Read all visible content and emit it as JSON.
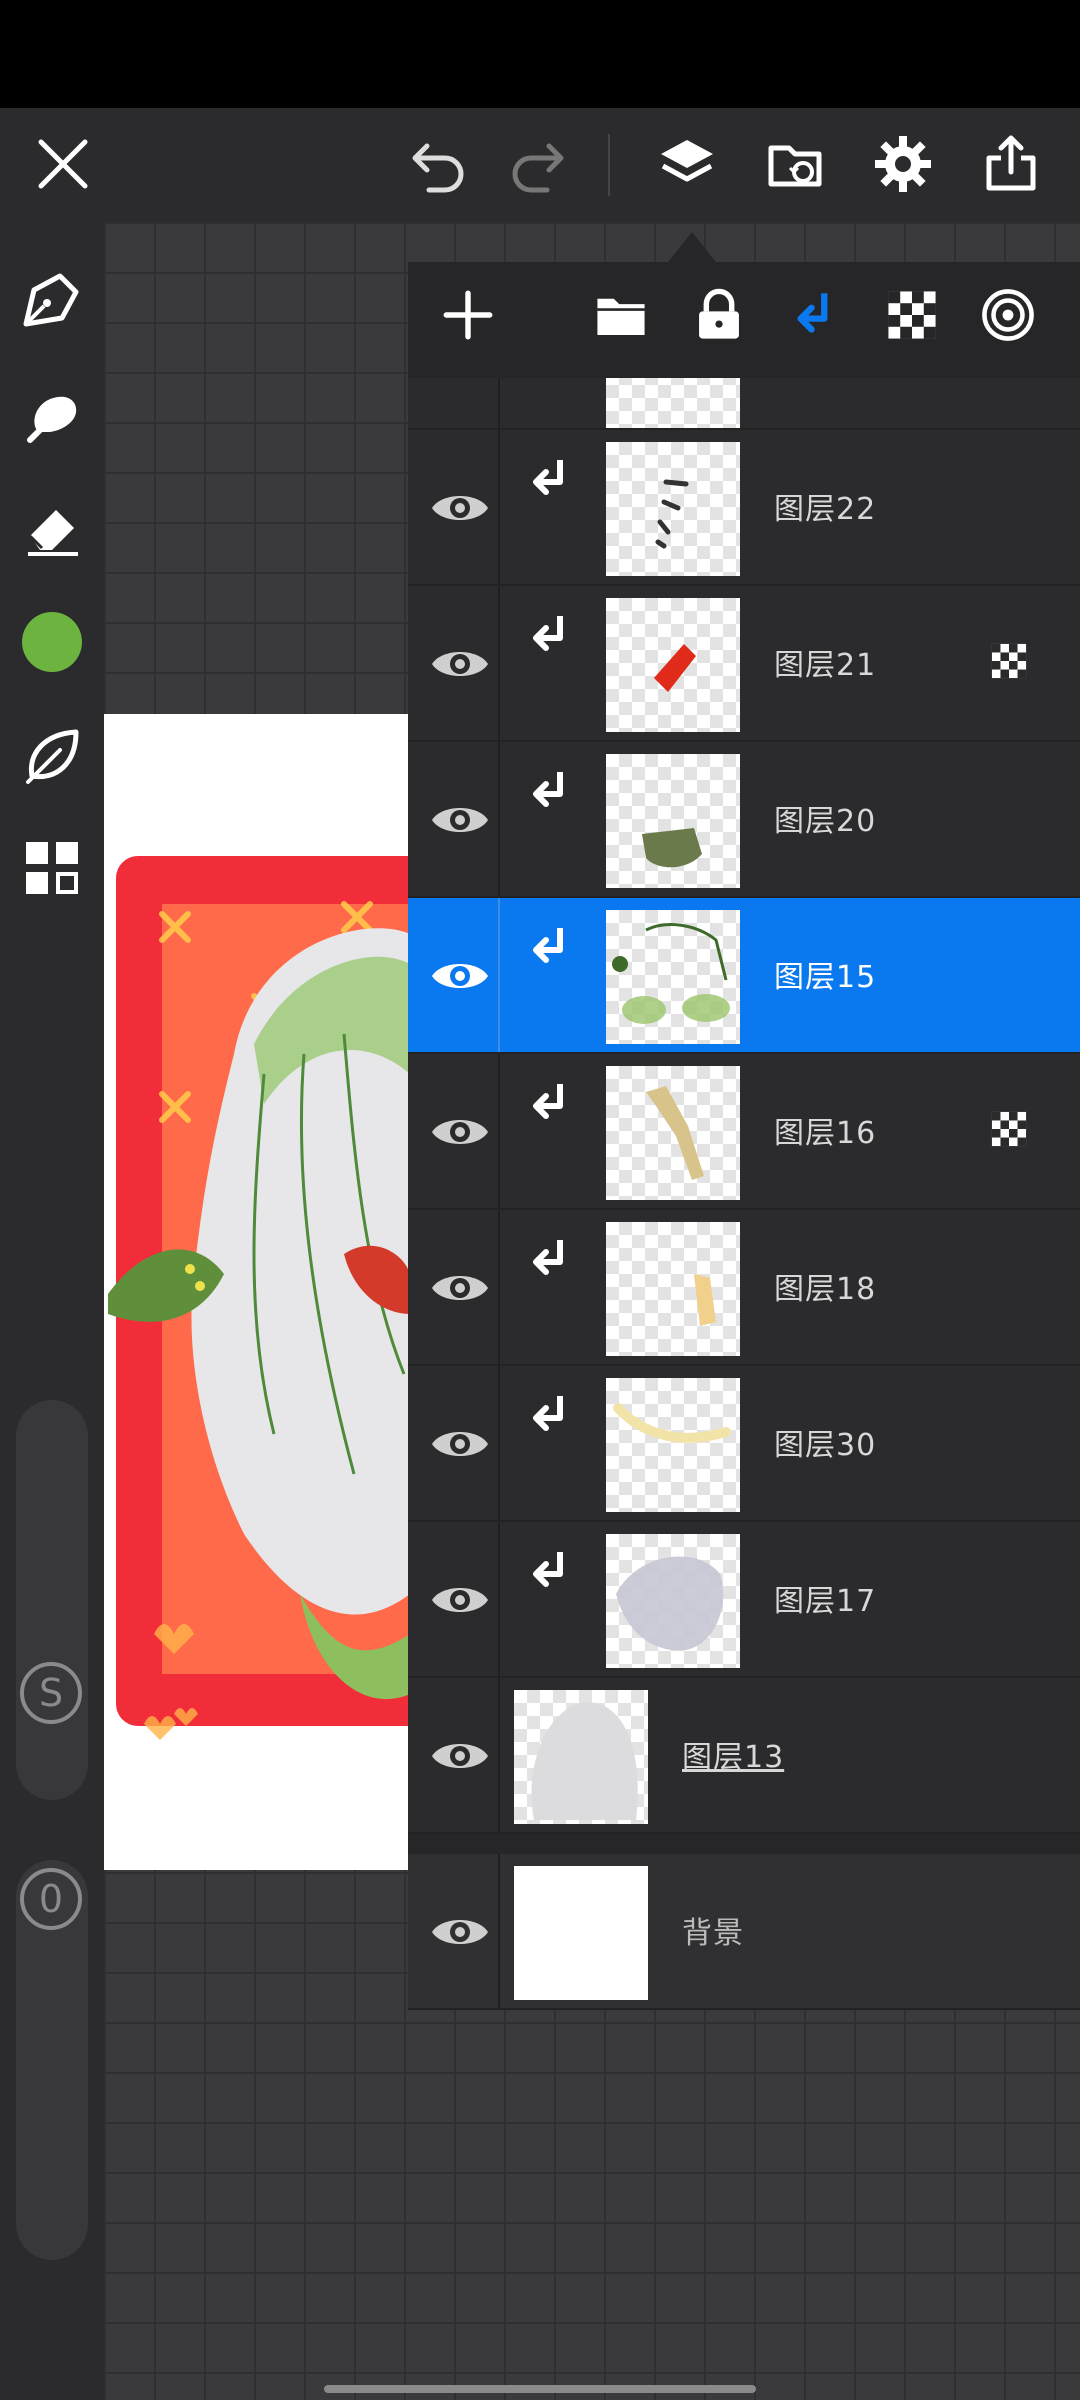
{
  "app": {
    "accent_color": "#0a79f0",
    "brush_color": "#6db33f"
  },
  "toolbar": {
    "icons": [
      "close-icon",
      "undo-icon",
      "redo-icon",
      "layers-icon",
      "import-image-icon",
      "settings-icon",
      "share-icon"
    ]
  },
  "left_tools": {
    "icons": [
      "pen-icon",
      "smudge-icon",
      "eraser-icon",
      "color-swatch",
      "leaf-icon",
      "grid-icon"
    ],
    "size_label": "S",
    "opacity_label": "0"
  },
  "layers_panel": {
    "toolbar_icons": [
      "add-layer-icon",
      "folder-icon",
      "lock-icon",
      "clip-icon",
      "alpha-lock-icon",
      "blend-icon"
    ],
    "layers": [
      {
        "name": "图层22",
        "clipped": true,
        "alpha_lock": false,
        "selected": false
      },
      {
        "name": "图层21",
        "clipped": true,
        "alpha_lock": true,
        "selected": false
      },
      {
        "name": "图层20",
        "clipped": true,
        "alpha_lock": false,
        "selected": false
      },
      {
        "name": "图层15",
        "clipped": true,
        "alpha_lock": false,
        "selected": true
      },
      {
        "name": "图层16",
        "clipped": true,
        "alpha_lock": true,
        "selected": false
      },
      {
        "name": "图层18",
        "clipped": true,
        "alpha_lock": false,
        "selected": false
      },
      {
        "name": "图层30",
        "clipped": true,
        "alpha_lock": false,
        "selected": false
      },
      {
        "name": "图层17",
        "clipped": true,
        "alpha_lock": false,
        "selected": false
      },
      {
        "name": "图层13",
        "clipped": false,
        "alpha_lock": false,
        "selected": false
      },
      {
        "name": "背景",
        "clipped": false,
        "alpha_lock": false,
        "selected": false
      }
    ]
  }
}
